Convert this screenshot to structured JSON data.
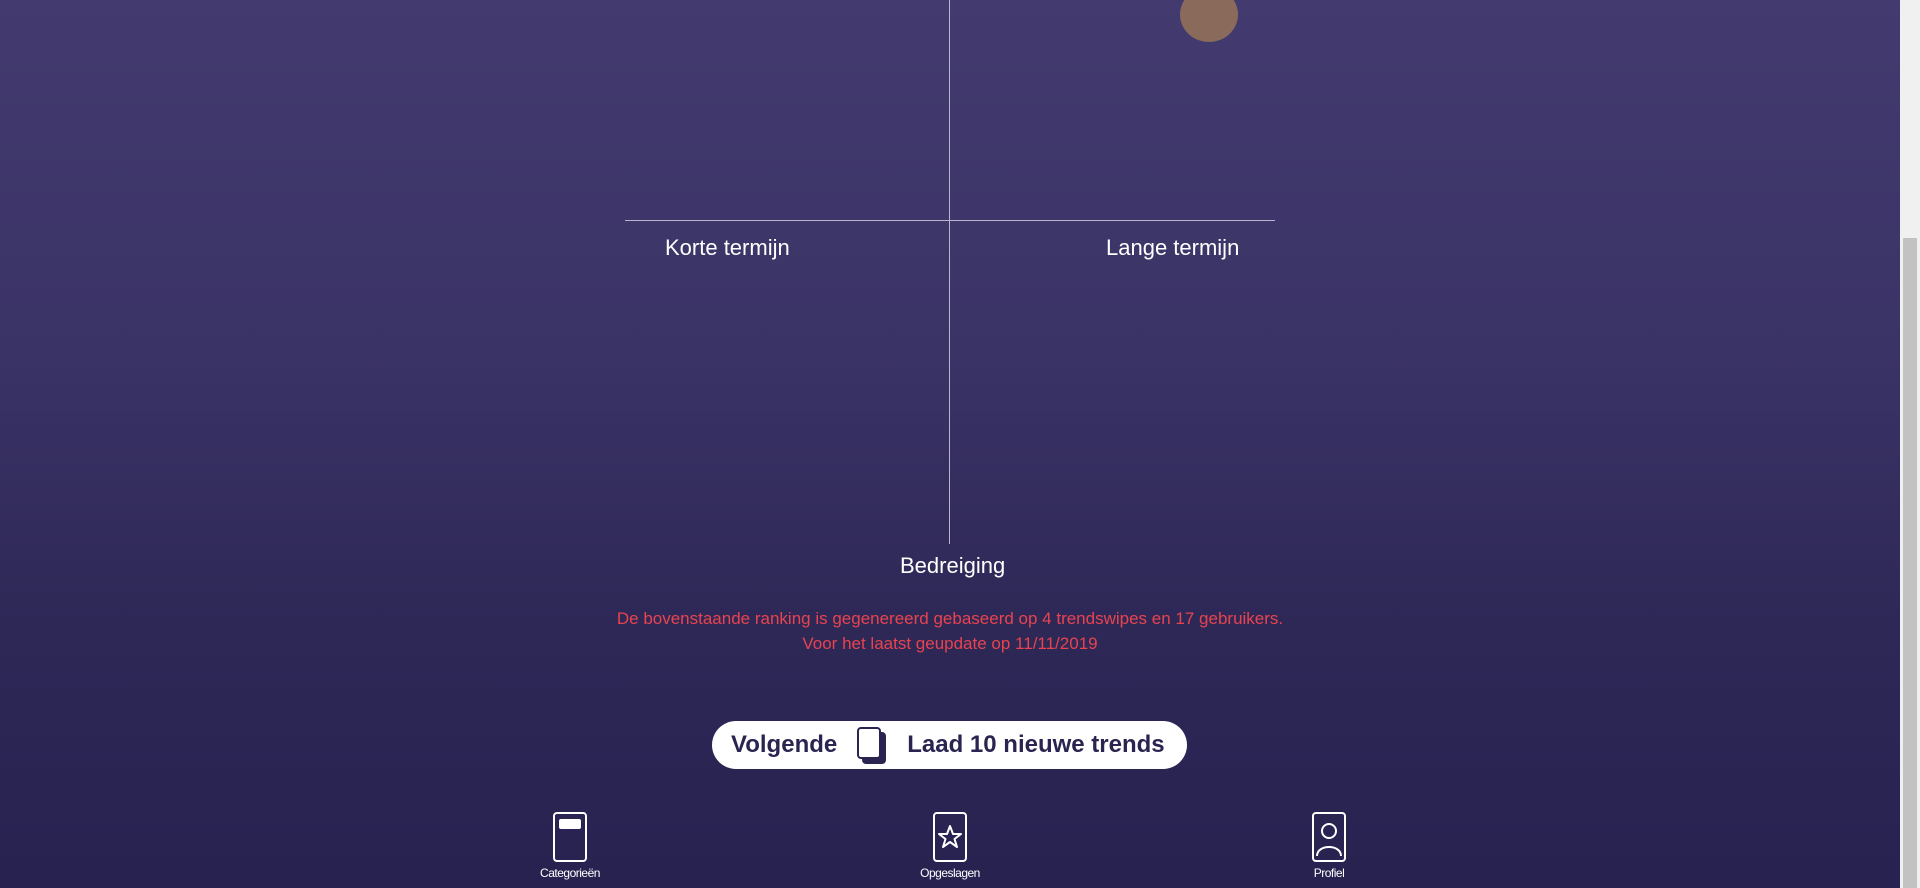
{
  "quadrant": {
    "label_left": "Korte termijn",
    "label_right": "Lange termijn",
    "label_bottom": "Bedreiging"
  },
  "info": {
    "line1": "De bovenstaande ranking is gegenereerd gebaseerd op 4 trendswipes en 17 gebruikers.",
    "line2": "Voor het laatst geupdate op 11/11/2019"
  },
  "next_button": {
    "label": "Volgende",
    "icon": "cards-icon",
    "action_label": "Laad 10 nieuwe trends"
  },
  "bottom_nav": {
    "items": [
      {
        "label": "Categorieën",
        "icon": "category-card-icon"
      },
      {
        "label": "Opgeslagen",
        "icon": "star-card-icon"
      },
      {
        "label": "Profiel",
        "icon": "profile-card-icon"
      }
    ]
  },
  "colors": {
    "background_top": "#433b6f",
    "background_bottom": "#272250",
    "info_text": "#e8434f",
    "trend_dot": "#8a6a5a",
    "button_text": "#2a2550"
  }
}
